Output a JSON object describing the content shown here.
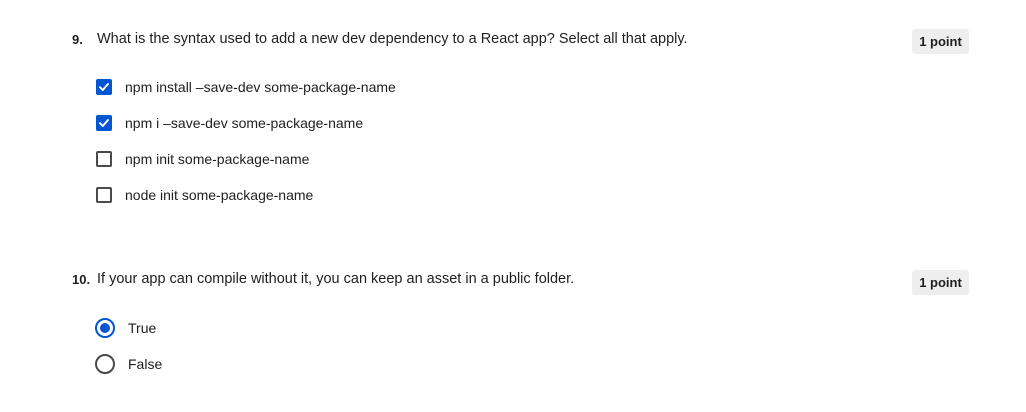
{
  "questions": [
    {
      "number": "9.",
      "text": "What is the syntax used to add a new dev dependency to a React app? Select all that apply.",
      "points": "1 point",
      "type": "checkbox",
      "options": [
        {
          "label": "npm install –save-dev some-package-name",
          "checked": true
        },
        {
          "label": "npm i –save-dev some-package-name",
          "checked": true
        },
        {
          "label": "npm init some-package-name",
          "checked": false
        },
        {
          "label": "node init some-package-name",
          "checked": false
        }
      ]
    },
    {
      "number": "10.",
      "text": "If your app can compile without it, you can keep an asset in a public folder.",
      "points": "1 point",
      "type": "radio",
      "options": [
        {
          "label": "True",
          "checked": true
        },
        {
          "label": "False",
          "checked": false
        }
      ]
    }
  ],
  "colors": {
    "accent": "#0056d2",
    "badge_bg": "#eeeeee",
    "text": "#1f1f1f"
  }
}
